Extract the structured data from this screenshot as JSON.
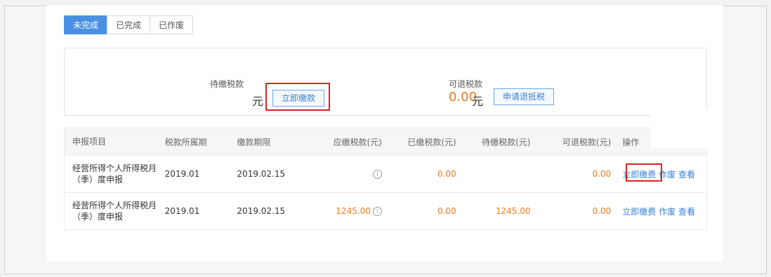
{
  "tabs": [
    {
      "label": "未完成",
      "active": true
    },
    {
      "label": "已完成",
      "active": false
    },
    {
      "label": "已作废",
      "active": false
    }
  ],
  "summary": {
    "pending": {
      "label": "待缴税款",
      "amount": "",
      "unit": "元",
      "button": "立即缴款"
    },
    "refundable": {
      "label": "可退税款",
      "amount": "0.00",
      "unit": "元",
      "button": "申请退抵税"
    }
  },
  "table": {
    "headers": [
      "申报项目",
      "税款所属期",
      "缴款期限",
      "应缴税款(元)",
      "已缴税款(元)",
      "待缴税款(元)",
      "可退税款(元)",
      "操作"
    ],
    "rows": [
      {
        "item": "经营所得个人所得税月（季）度申报",
        "period": "2019.01",
        "deadline": "2019.02.15",
        "payable": "",
        "paid": "0.00",
        "pending": "",
        "refundable": "0.00",
        "actions": [
          "立即缴费",
          "作废",
          "查看"
        ]
      },
      {
        "item": "经营所得个人所得税月（季）度申报",
        "period": "2019.01",
        "deadline": "2019.02.15",
        "payable": "1245.00",
        "paid": "0.00",
        "pending": "1245.00",
        "refundable": "0.00",
        "actions": [
          "立即缴费",
          "作废",
          "查看"
        ]
      }
    ]
  },
  "colors": {
    "accent": "#4a90e2",
    "amount": "#f07a1e",
    "highlight": "#dd2222"
  }
}
